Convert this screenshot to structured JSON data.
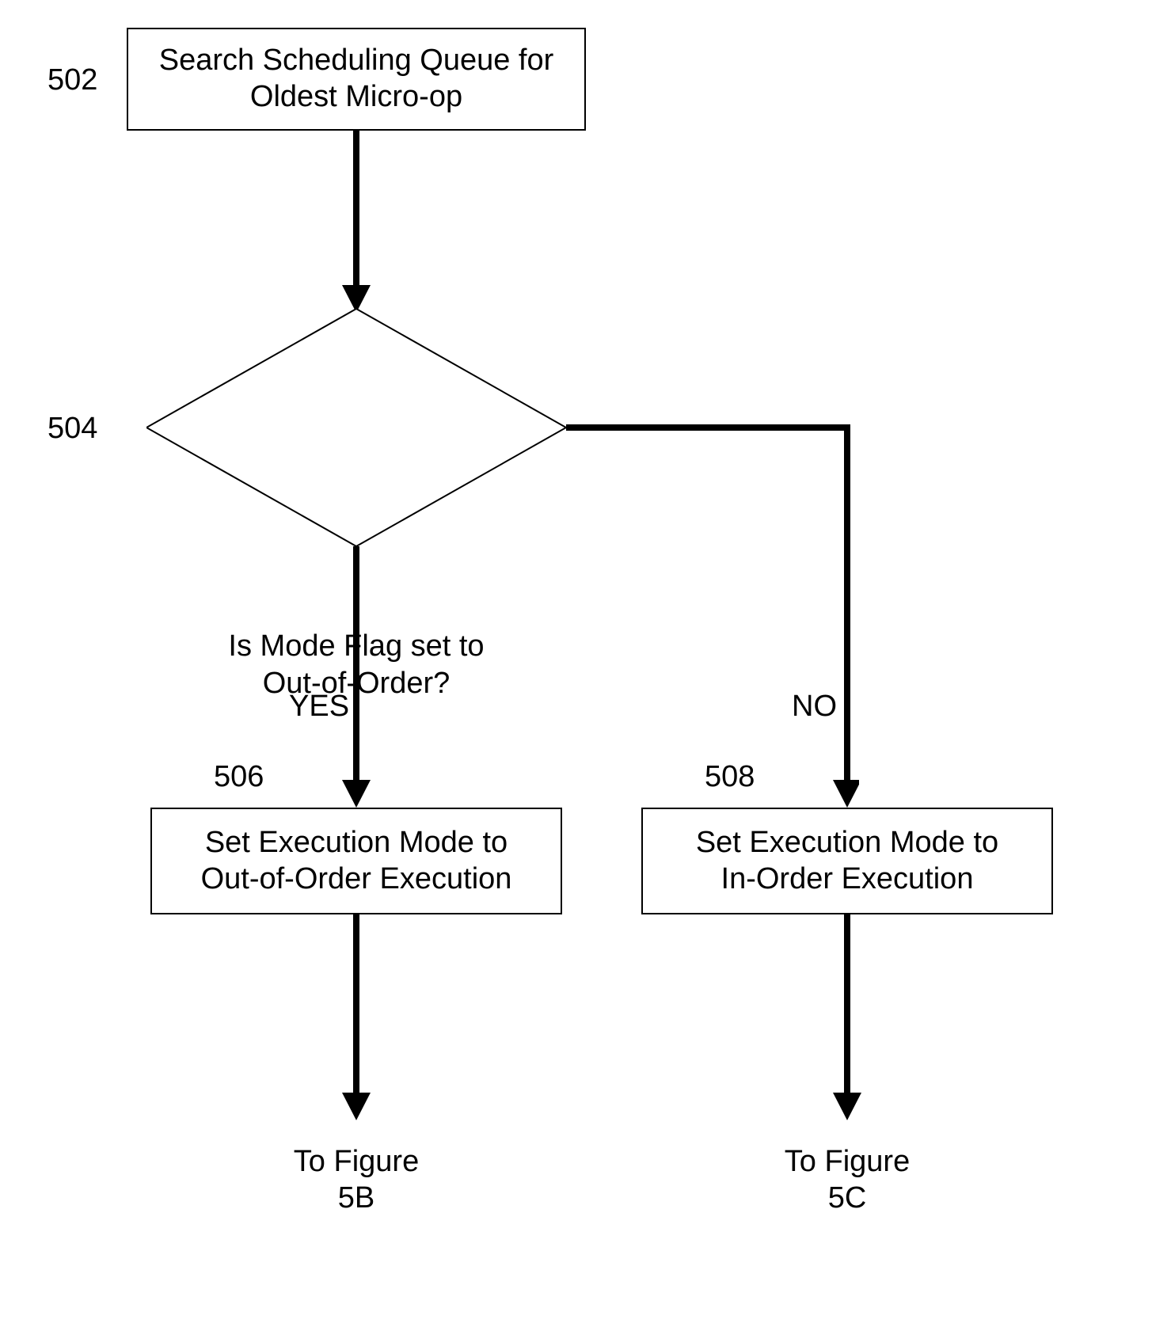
{
  "refs": {
    "r502": "502",
    "r504": "504",
    "r506": "506",
    "r508": "508"
  },
  "boxes": {
    "b502": "Search Scheduling Queue for\nOldest Micro-op",
    "b506": "Set Execution Mode to\nOut-of-Order Execution",
    "b508": "Set Execution Mode to\nIn-Order Execution"
  },
  "decision": {
    "d504": "Is Mode Flag set to\nOut-of-Order?"
  },
  "branches": {
    "yes": "YES",
    "no": "NO"
  },
  "exits": {
    "left": "To Figure\n5B",
    "right": "To Figure\n5C"
  }
}
